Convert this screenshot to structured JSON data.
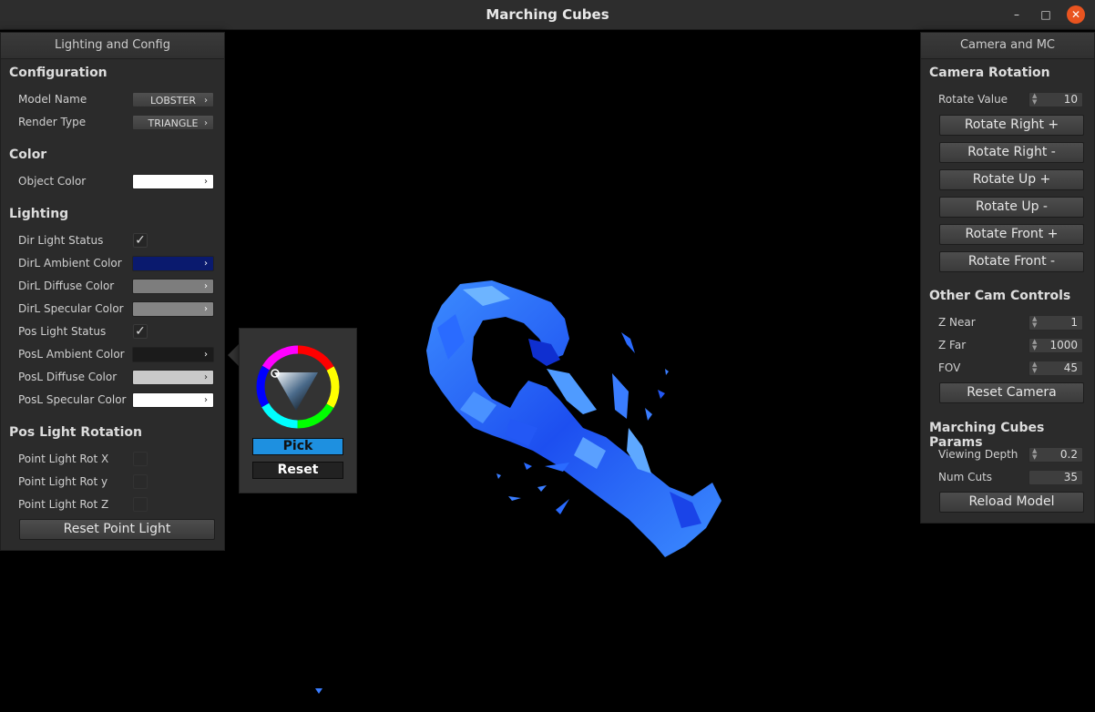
{
  "window": {
    "title": "Marching Cubes"
  },
  "left_panel": {
    "header": "Lighting and Config",
    "configuration": {
      "heading": "Configuration",
      "model_name_label": "Model Name",
      "model_name_value": "LOBSTER",
      "render_type_label": "Render Type",
      "render_type_value": "TRIANGLE"
    },
    "color": {
      "heading": "Color",
      "object_color_label": "Object Color",
      "object_color": "#ffffff"
    },
    "lighting": {
      "heading": "Lighting",
      "dir_light_status_label": "Dir Light Status",
      "dir_light_status": true,
      "dirl_ambient_label": "DirL Ambient Color",
      "dirl_ambient_color": "#0a1a6e",
      "dirl_diffuse_label": "DirL Diffuse Color",
      "dirl_diffuse_color": "#7d7d7d",
      "dirl_specular_label": "DirL Specular Color",
      "dirl_specular_color": "#858585",
      "pos_light_status_label": "Pos Light Status",
      "pos_light_status": true,
      "posl_ambient_label": "PosL Ambient Color",
      "posl_ambient_color": "#1b1b1b",
      "posl_diffuse_label": "PosL Diffuse Color",
      "posl_diffuse_color": "#c9c9c9",
      "posl_specular_label": "PosL Specular Color",
      "posl_specular_color": "#ffffff"
    },
    "pos_light_rotation": {
      "heading": "Pos Light Rotation",
      "rot_x_label": "Point Light Rot X",
      "rot_x": false,
      "rot_y_label": "Point Light Rot y",
      "rot_y": false,
      "rot_z_label": "Point Light Rot Z",
      "rot_z": false,
      "reset_button": "Reset Point Light"
    }
  },
  "color_popup": {
    "pick_button": "Pick",
    "reset_button": "Reset"
  },
  "right_panel": {
    "header": "Camera and MC",
    "camera_rotation": {
      "heading": "Camera Rotation",
      "rotate_value_label": "Rotate Value",
      "rotate_value": "10",
      "buttons": [
        "Rotate Right +",
        "Rotate Right -",
        "Rotate Up +",
        "Rotate Up -",
        "Rotate Front +",
        "Rotate Front -"
      ]
    },
    "other_cam_controls": {
      "heading": "Other Cam Controls",
      "z_near_label": "Z Near",
      "z_near": "1",
      "z_far_label": "Z Far",
      "z_far": "1000",
      "fov_label": "FOV",
      "fov": "45",
      "reset_camera_button": "Reset Camera"
    },
    "marching_cubes_params": {
      "heading": "Marching Cubes Params",
      "viewing_depth_label": "Viewing Depth",
      "viewing_depth": "0.2",
      "num_cuts_label": "Num Cuts",
      "num_cuts": "35",
      "reload_button": "Reload Model"
    }
  },
  "colors": {
    "model_blue": "#1f5aff",
    "model_highlight": "#5fa8ff",
    "accent": "#1e90e0"
  }
}
